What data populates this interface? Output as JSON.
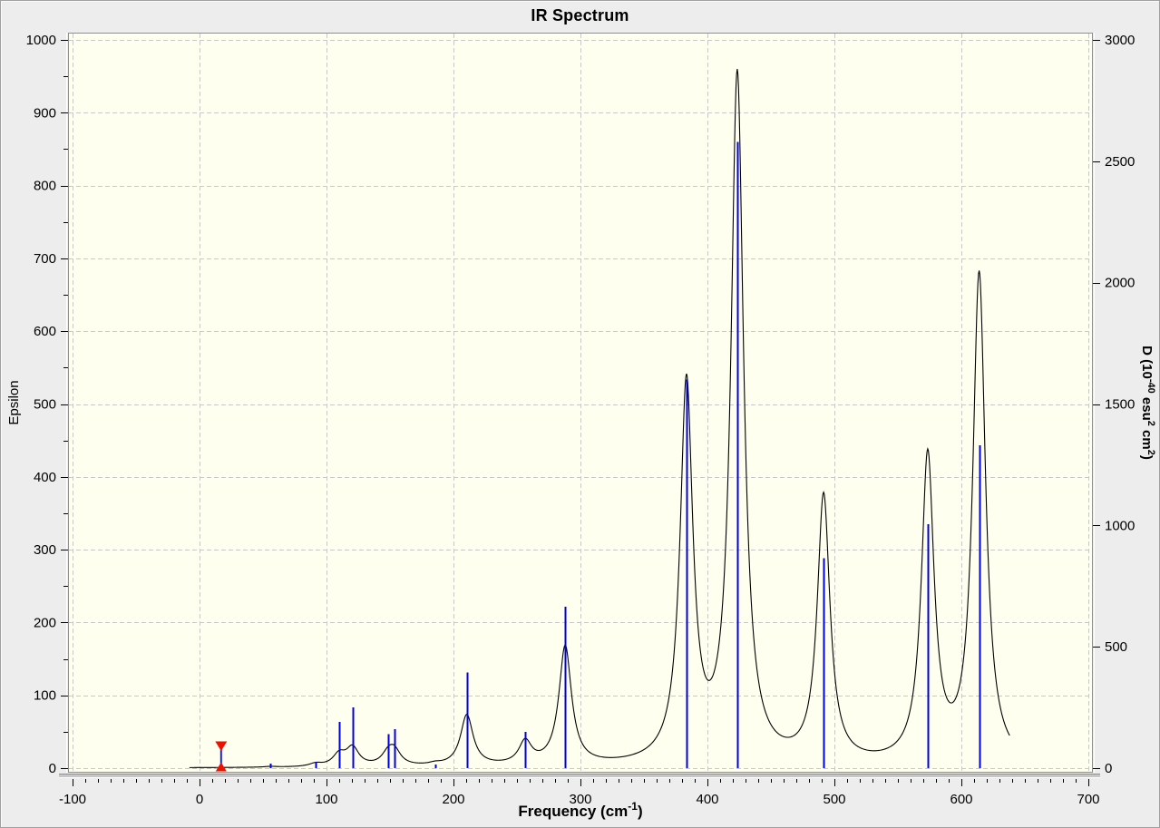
{
  "title": "IR Spectrum",
  "colors": {
    "window_bg": "#ededed",
    "plot_bg": "#fffff0",
    "plot_border": "#8f8f8f",
    "grid": "#c8c8c8",
    "curve": "#000000",
    "stick": "#0000dd",
    "marker_red": "#ee1100",
    "marker_line": "#2222cc",
    "axis_band_dark": "#909090",
    "axis_band_mid": "#c6c6c6",
    "axis_band_light": "#ffffff",
    "tick": "#000000",
    "text": "#000000"
  },
  "axes": {
    "x": {
      "label_segments": [
        {
          "t": "Frequency (cm"
        },
        {
          "t": "-1",
          "sup": true
        },
        {
          "t": ")"
        }
      ],
      "tick_labels": [
        "-100",
        "0",
        "100",
        "200",
        "300",
        "400",
        "500",
        "600",
        "700"
      ],
      "minor_step": 10
    },
    "y_left": {
      "label": "Epsilon",
      "tick_labels": [
        "0",
        "100",
        "200",
        "300",
        "400",
        "500",
        "600",
        "700",
        "800",
        "900",
        "1000"
      ],
      "minor_step": 50
    },
    "y_right": {
      "label_segments": [
        {
          "t": "D (10"
        },
        {
          "t": "-40",
          "sup": true
        },
        {
          "t": " esu"
        },
        {
          "t": "2",
          "sup": true
        },
        {
          "t": " cm"
        },
        {
          "t": "2",
          "sup": true
        },
        {
          "t": ")"
        }
      ],
      "tick_labels": [
        "0",
        "500",
        "1000",
        "1500",
        "2000",
        "2500",
        "3000"
      ]
    }
  },
  "chart_data": {
    "type": "line",
    "subtype": "ir-spectrum-with-stick-lines",
    "title": "IR Spectrum",
    "xlabel": "Frequency (cm^-1)",
    "ylabel_left": "Epsilon",
    "ylabel_right": "D (10^-40 esu^2 cm^2)",
    "xlim": [
      -100,
      700
    ],
    "ylim_left": [
      0,
      1000
    ],
    "ylim_right": [
      0,
      3000
    ],
    "x_major": 100,
    "x_minor": 10,
    "y_left_major": 100,
    "y_left_minor": 50,
    "y_right_major": 500,
    "grid": "dashed",
    "legend": "none",
    "sticks_axis": "right",
    "sticks": [
      {
        "freq": 56,
        "D": 18
      },
      {
        "freq": 91.5,
        "D": 26
      },
      {
        "freq": 110,
        "D": 190
      },
      {
        "freq": 120.5,
        "D": 250
      },
      {
        "freq": 148.5,
        "D": 140
      },
      {
        "freq": 153.5,
        "D": 160
      },
      {
        "freq": 185.5,
        "D": 15
      },
      {
        "freq": 210.5,
        "D": 395
      },
      {
        "freq": 256.5,
        "D": 150
      },
      {
        "freq": 288,
        "D": 665
      },
      {
        "freq": 383.5,
        "D": 1600
      },
      {
        "freq": 423.5,
        "D": 2580
      },
      {
        "freq": 491.5,
        "D": 865
      },
      {
        "freq": 573.5,
        "D": 1005
      },
      {
        "freq": 614,
        "D": 1330
      }
    ],
    "curve_peaks_epsilon": [
      {
        "freq": 108,
        "eps": 24
      },
      {
        "freq": 121,
        "eps": 31
      },
      {
        "freq": 151,
        "eps": 32
      },
      {
        "freq": 212,
        "eps": 72
      },
      {
        "freq": 257,
        "eps": 37
      },
      {
        "freq": 288,
        "eps": 168
      },
      {
        "freq": 384,
        "eps": 539
      },
      {
        "freq": 424,
        "eps": 951
      },
      {
        "freq": 491,
        "eps": 371
      },
      {
        "freq": 573,
        "eps": 427
      },
      {
        "freq": 614,
        "eps": 680
      }
    ],
    "curve_components": [
      {
        "freq": 56,
        "A": 1
      },
      {
        "freq": 91.5,
        "A": 4
      },
      {
        "freq": 110,
        "A": 16
      },
      {
        "freq": 120.5,
        "A": 25
      },
      {
        "freq": 148.5,
        "A": 15
      },
      {
        "freq": 153.5,
        "A": 19
      },
      {
        "freq": 185.5,
        "A": 2.5
      },
      {
        "freq": 210.5,
        "A": 70
      },
      {
        "freq": 256.5,
        "A": 31
      },
      {
        "freq": 288,
        "A": 163
      },
      {
        "freq": 383.5,
        "A": 518
      },
      {
        "freq": 423.5,
        "A": 944
      },
      {
        "freq": 491.5,
        "A": 366
      },
      {
        "freq": 573.5,
        "A": 420
      },
      {
        "freq": 614,
        "A": 672
      }
    ],
    "lorentzian_halfwidth_cm1": 6,
    "curve_xrange": [
      -8,
      638
    ],
    "marker": {
      "freq": 17,
      "line_top_epsilon": 28
    }
  }
}
